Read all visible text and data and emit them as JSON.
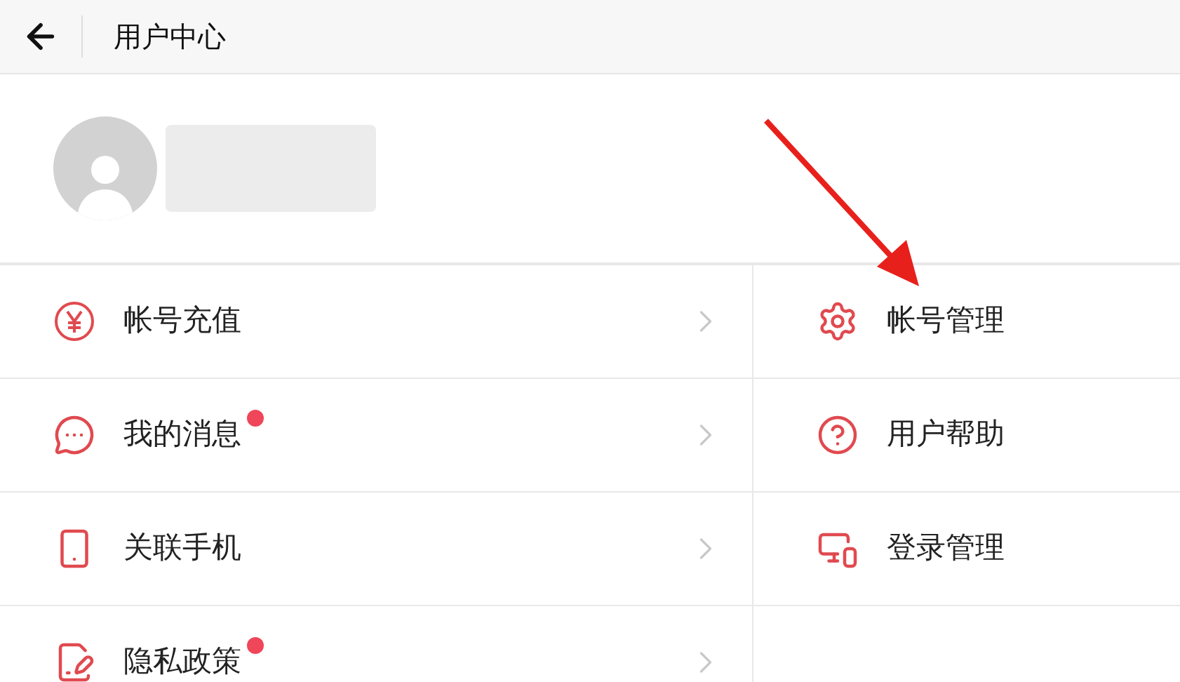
{
  "header": {
    "title": "用户中心"
  },
  "menu_left": [
    {
      "label": "帐号充值",
      "unread": false
    },
    {
      "label": "我的消息",
      "unread": true
    },
    {
      "label": "关联手机",
      "unread": false
    },
    {
      "label": "隐私政策",
      "unread": true
    }
  ],
  "menu_right": [
    {
      "label": "帐号管理"
    },
    {
      "label": "用户帮助"
    },
    {
      "label": "登录管理"
    }
  ]
}
